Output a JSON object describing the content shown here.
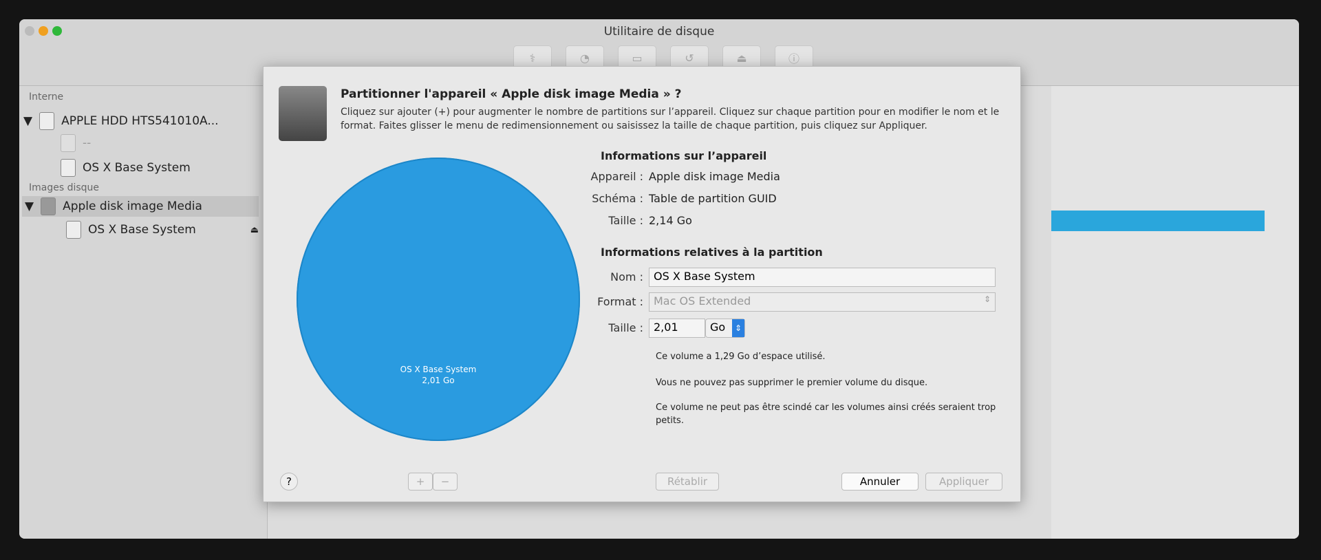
{
  "window": {
    "title": "Utilitaire de disque"
  },
  "toolbar": [
    {
      "label": "S.O.S.",
      "icon": "stethoscope-icon",
      "glyph": "⚕"
    },
    {
      "label": "Partitionner",
      "icon": "partition-icon",
      "glyph": "◔"
    },
    {
      "label": "Effacer",
      "icon": "erase-icon",
      "glyph": "▭"
    },
    {
      "label": "Restaurer",
      "icon": "restore-icon",
      "glyph": "↺"
    },
    {
      "label": "Monter",
      "icon": "mount-icon",
      "glyph": "⏏"
    },
    {
      "label": "Infos",
      "icon": "info-icon",
      "glyph": "ⓘ"
    }
  ],
  "sidebar": {
    "internal_label": "Interne",
    "hdd": "APPLE HDD HTS541010A...",
    "hdd_child": "--",
    "hdd_volume": "OS X Base System",
    "images_label": "Images disque",
    "image": "Apple disk image Media",
    "image_volume": "OS X Base System"
  },
  "sheet": {
    "title": "Partitionner l'appareil « Apple disk image Media » ?",
    "description": "Cliquez sur ajouter (+) pour augmenter le nombre de partitions sur l’appareil. Cliquez sur chaque partition pour en modifier le nom et le format. Faites glisser le menu de redimensionnement ou saisissez la taille de chaque partition, puis cliquez sur Appliquer.",
    "pie": {
      "name": "OS X Base System",
      "size": "2,01 Go",
      "color": "#2a9be0"
    },
    "device_heading": "Informations sur l’appareil",
    "device": {
      "label_device": "Appareil :",
      "device": "Apple disk image Media",
      "label_scheme": "Schéma :",
      "scheme": "Table de partition GUID",
      "label_size": "Taille :",
      "size": "2,14 Go"
    },
    "partition_heading": "Informations relatives à la partition",
    "partition": {
      "label_name": "Nom :",
      "name": "OS X Base System",
      "label_format": "Format :",
      "format": "Mac OS Extended",
      "label_size": "Taille :",
      "size": "2,01",
      "unit": "Go"
    },
    "notes": [
      "Ce volume a 1,29 Go d’espace utilisé.",
      "Vous ne pouvez pas supprimer le premier volume du disque.",
      "Ce volume ne peut pas être scindé car les volumes ainsi créés seraient trop petits."
    ],
    "buttons": {
      "help": "?",
      "add": "+",
      "remove": "−",
      "revert": "Rétablir",
      "cancel": "Annuler",
      "apply": "Appliquer"
    }
  }
}
